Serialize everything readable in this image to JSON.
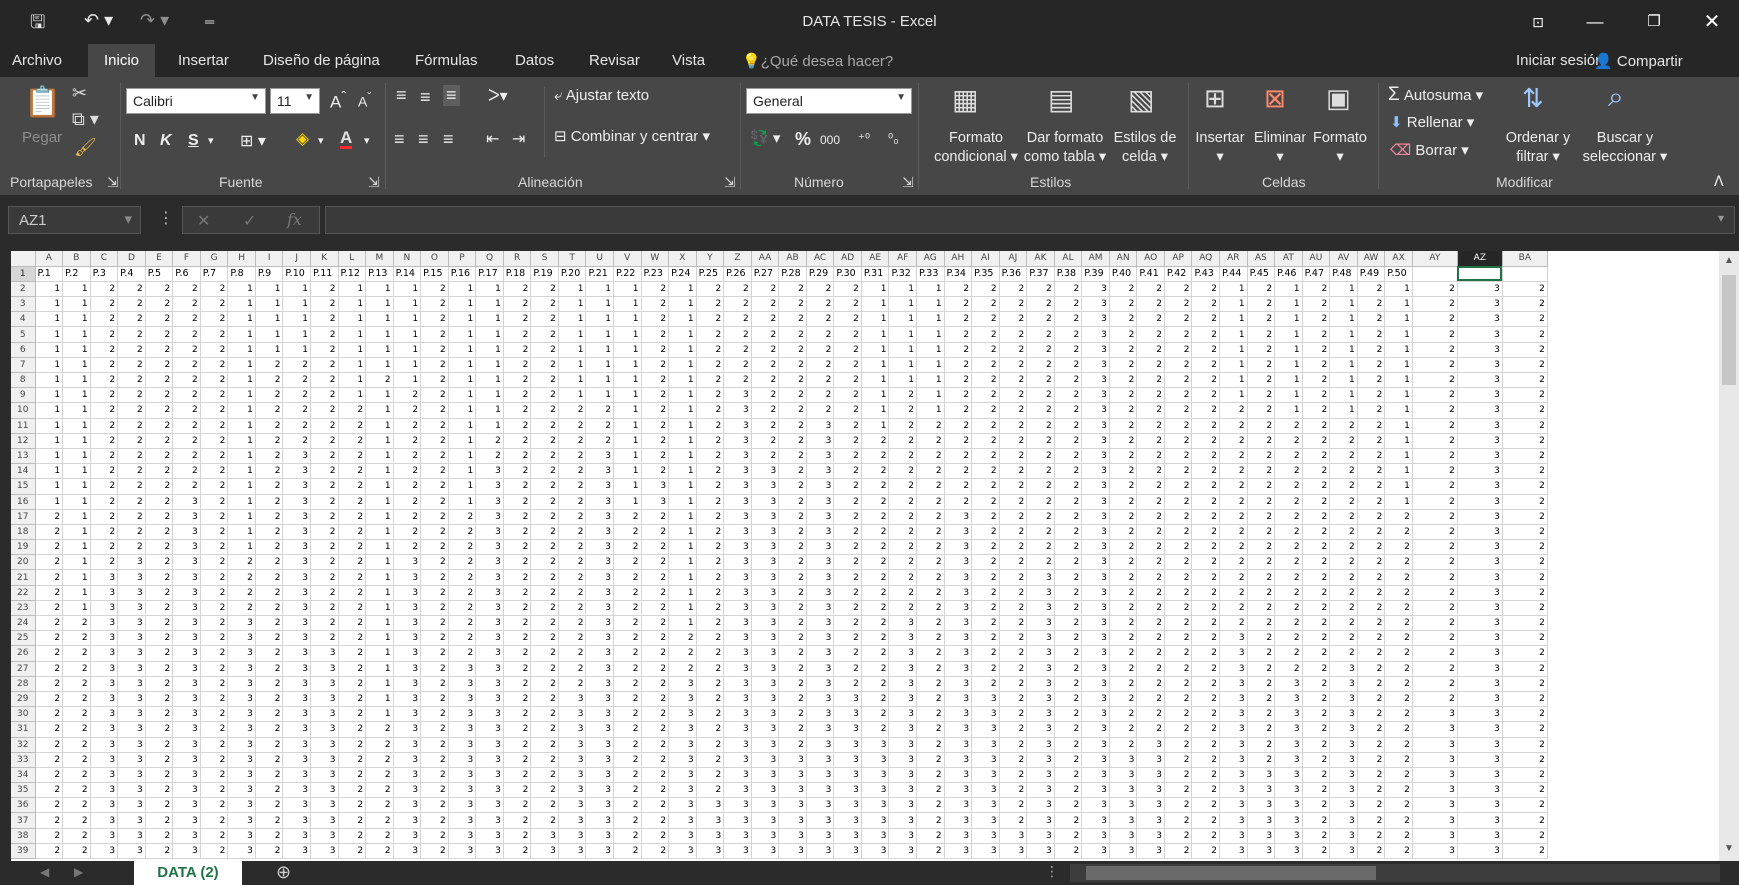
{
  "window": {
    "title": "DATA TESIS - Excel"
  },
  "menu": {
    "items": [
      "Archivo",
      "Inicio",
      "Insertar",
      "Diseño de página",
      "Fórmulas",
      "Datos",
      "Revisar",
      "Vista"
    ],
    "tell_me": "¿Qué desea hacer?",
    "signin": "Iniciar sesión",
    "share": "Compartir"
  },
  "ribbon": {
    "paste": "Pegar",
    "font_name": "Calibri",
    "font_size": "11",
    "bold": "N",
    "italic": "K",
    "underline": "S",
    "wrap_text": "Ajustar texto",
    "merge_center": "Combinar y centrar",
    "number_format": "General",
    "percent": "%",
    "thousands": "000",
    "cond_format": [
      "Formato",
      "condicional ▾"
    ],
    "format_table": [
      "Dar formato",
      "como tabla ▾"
    ],
    "cell_styles": [
      "Estilos de",
      "celda ▾"
    ],
    "insert": "Insertar",
    "delete": "Eliminar",
    "format": "Formato",
    "autosum": "Autosuma",
    "fill": "Rellenar",
    "clear": "Borrar",
    "sort": [
      "Ordenar y",
      "filtrar ▾"
    ],
    "find": [
      "Buscar y",
      "seleccionar ▾"
    ],
    "groups": {
      "clipboard": "Portapapeles",
      "font": "Fuente",
      "alignment": "Alineación",
      "number": "Número",
      "styles": "Estilos",
      "cells": "Celdas",
      "editing": "Modificar"
    }
  },
  "formula_bar": {
    "name_box": "AZ1",
    "fx": "fx",
    "content": ""
  },
  "sheet": {
    "tab": "DATA (2)",
    "columns": [
      "A",
      "B",
      "C",
      "D",
      "E",
      "F",
      "G",
      "H",
      "I",
      "J",
      "K",
      "L",
      "M",
      "N",
      "O",
      "P",
      "Q",
      "R",
      "S",
      "T",
      "U",
      "V",
      "W",
      "X",
      "Y",
      "Z",
      "AA",
      "AB",
      "AC",
      "AD",
      "AE",
      "AF",
      "AG",
      "AH",
      "AI",
      "AJ",
      "AK",
      "AL",
      "AM",
      "AN",
      "AO",
      "AP",
      "AQ",
      "AR",
      "AS",
      "AT",
      "AU",
      "AV",
      "AW",
      "AX",
      "AY",
      "AZ",
      "BA"
    ],
    "headers": [
      "P.1",
      "P.2",
      "P.3",
      "P.4",
      "P.5",
      "P.6",
      "P.7",
      "P.8",
      "P.9",
      "P.10",
      "P.11",
      "P.12",
      "P.13",
      "P.14",
      "P.15",
      "P.16",
      "P.17",
      "P.18",
      "P.19",
      "P.20",
      "P.21",
      "P.22",
      "P.23",
      "P.24",
      "P.25",
      "P.26",
      "P.27",
      "P.28",
      "P.29",
      "P.30",
      "P.31",
      "P.32",
      "P.33",
      "P.34",
      "P.35",
      "P.36",
      "P.37",
      "P.38",
      "P.39",
      "P.40",
      "P.41",
      "P.42",
      "P.43",
      "P.44",
      "P.45",
      "P.46",
      "P.47",
      "P.48",
      "P.49",
      "P.50"
    ],
    "rows": [
      "11222221112111211221112122222211122222322221212121232311",
      "11222221112111211221112122222211122222322221212121232311",
      "11222221112111211221112122222211122222322221212121232311",
      "11222221112111211221112122222211122222322221212121232311",
      "11222221112111211221112122222211122222322221212121232311",
      "11222221222111211221112122222211122222322221212121232311",
      "11222221222121211221112122222211122222322221212121232311",
      "11222221222112211221112123222212122222322221212121232311",
      "11222221222212211222212123222212122222322222212121232311",
      "11222221222212211222212123223212222222322222222221232311",
      "11222221222212212222212123223222222222322222222221232311",
      "11222221232212212222312123223222222222322222222221232311",
      "11222221232212213222312123323222222222322222222221232311",
      "11222221232212213222313123323222222222322222222221232311",
      "11222321232212213222313123323222222222322222222221232311",
      "21222321232212223222322123323222232222322222222222232311",
      "21222321232212223222322123323222232222322222222222232311",
      "21222321232212223222322123323222232222322222222222232311",
      "21232322232213223222322123323222232222322222222222232311",
      "21332322232213223222322123323222232232322222222222232311",
      "21332322232213223222322123323222232232322222222222232311",
      "21332322232213223222322123323222232232322222222222232311",
      "22332323232213223222322123323223232232322222222222232311",
      "22332323232213223222322223323223232232322223222222232311",
      "22332323233213223222322223323223232232322223222222232311",
      "22332323233213233222322223323223232232322223222322232311",
      "22332323233213233222322323323223232232322223232322232311",
      "22332323233213233223322323323323233232322223232322232311",
      "22332323233213233223322323323323233232322223232322332311",
      "22332323233223233223322323323323233232322223232322332311",
      "22332323233223233223322323323333233232323223232322332321",
      "22332323233223233223322323333333233232333223232322332321",
      "22332323233223233223322323333333233232333223332322332321",
      "22332323233223233223322323333333233232333223332322332321",
      "22332323233223233223322333333333233232333223332322332321",
      "22332323233223233223322333333333233232333223332322332321",
      "22332323233223233233322333333333233332333223332322332221",
      "22332323233223233233322333333333233332333223332322332221"
    ]
  }
}
